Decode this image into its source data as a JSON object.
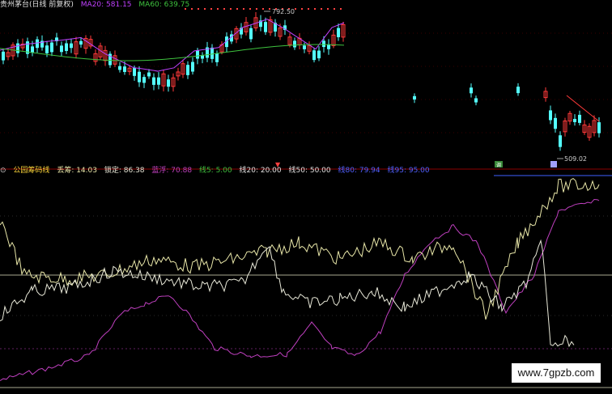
{
  "top_panel": {
    "title": "贵州茅台(日线 前复权)",
    "ma20_label": "MA20: 581.15",
    "ma60_label": "MA60: 639.75",
    "high_label": "792.50",
    "low_label": "509.02",
    "period": "日线"
  },
  "indicator_panel": {
    "name": "公园筹码线",
    "items": [
      {
        "text": "丢筹: 14.03"
      },
      {
        "text": "锁定: 86.38"
      },
      {
        "text": "蓝浮: 70.88"
      },
      {
        "text": "线5: 5.00"
      },
      {
        "text": "线20: 20.00"
      },
      {
        "text": "线50: 50.00"
      },
      {
        "text": "线80: 79.94"
      },
      {
        "text": "线95: 95.00"
      }
    ]
  },
  "markers": {
    "trade_flag": "调"
  },
  "watermark": "www.7gpzb.com",
  "colors": {
    "background": "#000000",
    "up_candle": "#ff3a3a",
    "down_candle": "#54ffff",
    "ma20": "#c040ff",
    "ma60": "#3ec23e",
    "pink_line": "#c040c0",
    "yellow_line": "#e8e6a8",
    "white_line": "#e8e8d8",
    "divider": "#8b0000",
    "title": "#e0e0e0",
    "ind_name": "#ffd83a"
  }
}
